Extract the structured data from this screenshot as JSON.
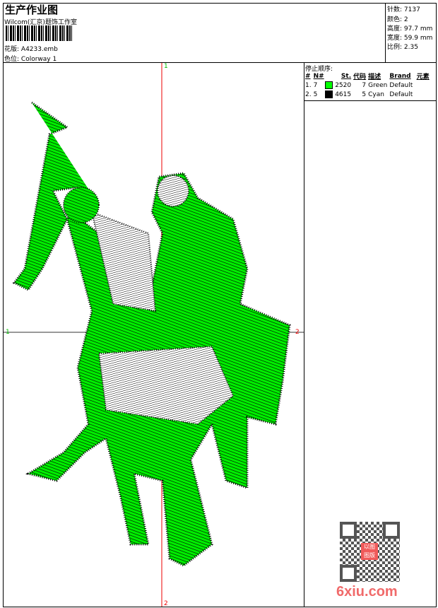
{
  "header": {
    "title": "生产作业图",
    "company": "Wilcom(汇京)题饰工作室",
    "design_label": "花版:",
    "design_value": "A4233.emb",
    "colorway_label": "色位:",
    "colorway_value": "Colorway 1"
  },
  "stats": [
    {
      "label": "针数:",
      "value": "7137"
    },
    {
      "label": "颜色:",
      "value": "2"
    },
    {
      "label": "高度:",
      "value": "97.7 mm"
    },
    {
      "label": "宽度:",
      "value": "59.9 mm"
    },
    {
      "label": "比例:",
      "value": "2.35"
    }
  ],
  "stop_sequence": {
    "title": "停止顺序:",
    "columns": [
      "#",
      "N#",
      "St.",
      "代码",
      "描述",
      "Brand",
      "元素"
    ],
    "rows": [
      {
        "idx": "1.",
        "n": "7",
        "color": "#00ff00",
        "st": "2520",
        "code": "7",
        "desc": "Green",
        "brand": "Default"
      },
      {
        "idx": "2.",
        "n": "5",
        "color": "#000000",
        "st": "4615",
        "code": "5",
        "desc": "Cyan",
        "brand": "Default"
      }
    ]
  },
  "axis_labels": {
    "top": "1",
    "left": "1",
    "right": "2",
    "bottom": "2"
  },
  "watermark": {
    "seal": "以图版",
    "site": "6xiu.com"
  }
}
